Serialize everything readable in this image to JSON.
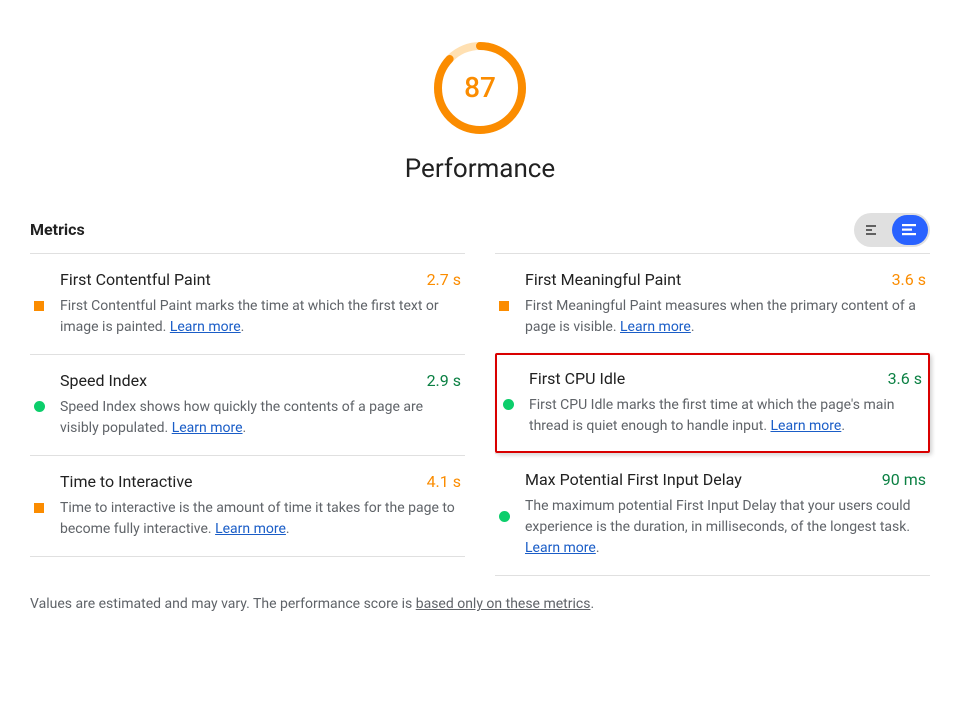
{
  "gauge": {
    "score": "87",
    "title": "Performance",
    "color": "#fb8c00",
    "bgColor": "#ffe0b2",
    "percent": 87
  },
  "sectionHeading": "Metrics",
  "learnMoreText": "Learn more",
  "metrics": {
    "left": [
      {
        "name": "First Contentful Paint",
        "value": "2.7 s",
        "status": "avg",
        "desc": "First Contentful Paint marks the time at which the first text or image is painted. "
      },
      {
        "name": "Speed Index",
        "value": "2.9 s",
        "status": "good",
        "desc": "Speed Index shows how quickly the contents of a page are visibly populated. "
      },
      {
        "name": "Time to Interactive",
        "value": "4.1 s",
        "status": "avg",
        "desc": "Time to interactive is the amount of time it takes for the page to become fully interactive. "
      }
    ],
    "right": [
      {
        "name": "First Meaningful Paint",
        "value": "3.6 s",
        "status": "avg",
        "desc": "First Meaningful Paint measures when the primary content of a page is visible. "
      },
      {
        "name": "First CPU Idle",
        "value": "3.6 s",
        "status": "good",
        "highlight": true,
        "desc": "First CPU Idle marks the first time at which the page's main thread is quiet enough to handle input. "
      },
      {
        "name": "Max Potential First Input Delay",
        "value": "90 ms",
        "status": "good",
        "desc": "The maximum potential First Input Delay that your users could experience is the duration, in milliseconds, of the longest task. "
      }
    ]
  },
  "footnote": {
    "prefix": "Values are estimated and may vary. The performance score is ",
    "linkText": "based only on these metrics",
    "suffix": "."
  }
}
